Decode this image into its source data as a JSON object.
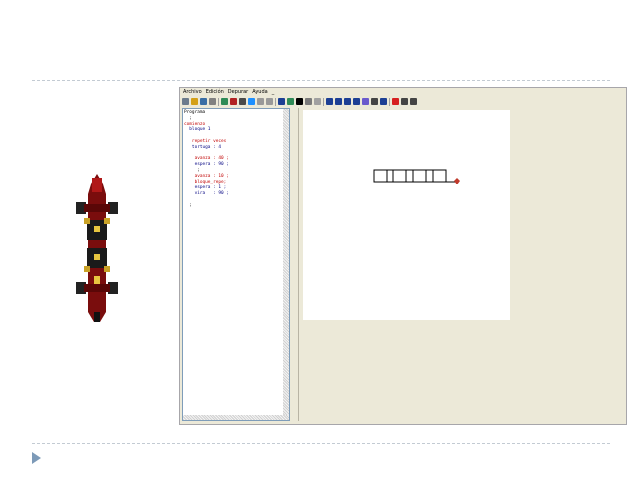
{
  "menu": [
    "Archivo",
    "Edición",
    "Depurar",
    "Ayuda",
    "_"
  ],
  "toolbar_icons": [
    "new-icon",
    "open-icon",
    "save-icon",
    "print-icon",
    "check-icon",
    "cut-icon",
    "copy-icon",
    "paste-icon",
    "undo-icon",
    "redo-icon",
    "step-icon",
    "run-icon",
    "stop-icon",
    "zoom-icon",
    "grid-icon",
    "pencil-icon",
    "line-icon",
    "rect-icon",
    "circle-icon",
    "fill-icon",
    "text-icon",
    "color-icon",
    "stop-sign-icon",
    "info-icon",
    "help-icon"
  ],
  "code_lines": [
    {
      "text": "Programa",
      "color": "#000000"
    },
    {
      "text": "  ;",
      "color": "#000000"
    },
    {
      "text": "comienzo",
      "color": "#c00000"
    },
    {
      "text": "  bloque 1",
      "color": "#000080"
    },
    {
      "text": "",
      "color": "#000000"
    },
    {
      "text": "   repetir veces",
      "color": "#c00000"
    },
    {
      "text": "   tortuga : 4",
      "color": "#000080"
    },
    {
      "text": "",
      "color": "#000000"
    },
    {
      "text": "    avanza : 40 ;",
      "color": "#c00000"
    },
    {
      "text": "    espera : 90 ;",
      "color": "#000080"
    },
    {
      "text": "     ;",
      "color": "#000000"
    },
    {
      "text": "    avanza : 10 ;",
      "color": "#c00000"
    },
    {
      "text": "    bloque_repe;",
      "color": "#c00000"
    },
    {
      "text": "    espera : 1 ;",
      "color": "#000080"
    },
    {
      "text": "    vira   : 90 ;",
      "color": "#000080"
    },
    {
      "text": "",
      "color": "#000000"
    },
    {
      "text": "  ;",
      "color": "#000000"
    }
  ]
}
